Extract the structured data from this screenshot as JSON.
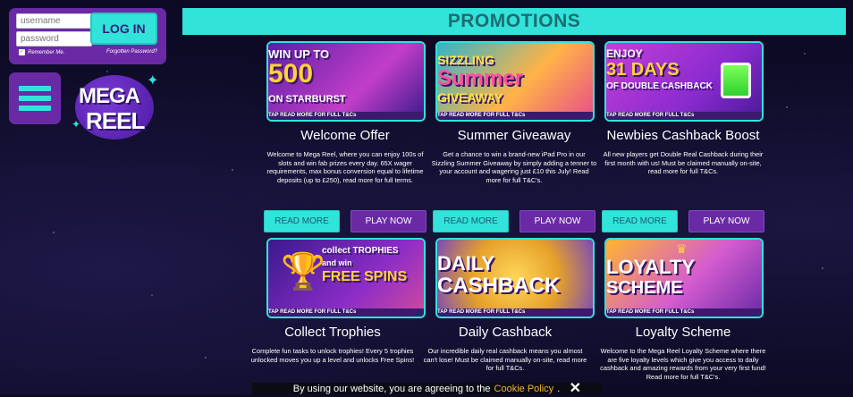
{
  "login": {
    "username_placeholder": "username",
    "password_placeholder": "password",
    "login_label": "LOG IN",
    "remember_label": "Remember Me.",
    "forgot_label": "Forgotten Password?"
  },
  "logo": {
    "line1": "MEGA",
    "line2": "REEL"
  },
  "header": {
    "title": "PROMOTIONS"
  },
  "buttons": {
    "read_more": "READ MORE",
    "play_now": "PLAY NOW"
  },
  "promos": [
    {
      "banner_text": "WIN UP TO 500 FREE SPINS ON STARBURST",
      "banner_line1": "WIN UP TO",
      "banner_line2": "500",
      "banner_line3": "ON STARBURST",
      "tap": "TAP READ MORE FOR FULL T&Cs",
      "title": "Welcome Offer",
      "desc": "Welcome to Mega Reel, where you can enjoy 100s of slots and win fab prizes every day. 65X wager requirements, max bonus conversion equal to lifetime deposits (up to £250), read more for full terms."
    },
    {
      "banner_line1": "SIZZLING",
      "banner_line2": "Summer",
      "banner_line3": "GIVEAWAY",
      "tap": "TAP READ MORE FOR FULL T&Cs",
      "title": "Summer Giveaway",
      "desc": "Get a chance to win a brand-new iPad Pro in our Sizzling Summer Giveaway by simply adding a tenner to your account and wagering just £10 this July! Read more for full T&C's."
    },
    {
      "banner_line1": "ENJOY",
      "banner_line2": "31 DAYS",
      "banner_line3": "OF DOUBLE CASHBACK",
      "tap": "TAP READ MORE FOR FULL T&Cs",
      "title": "Newbies Cashback Boost",
      "desc": "All new players get Double Real Cashback during their first month with us! Must be claimed manually on-site, read more for full T&Cs."
    },
    {
      "banner_line1": "collect TROPHIES",
      "banner_line2": "and win",
      "banner_line3": "FREE SPINS",
      "tap": "TAP READ MORE FOR FULL T&Cs",
      "title": "Collect Trophies",
      "desc": "Complete fun tasks to unlock trophies! Every 5 trophies unlocked moves you up a level and unlocks Free Spins!"
    },
    {
      "banner_line1": "DAILY",
      "banner_line2": "CASHBACK",
      "banner_line3": "",
      "tap": "TAP READ MORE FOR FULL T&Cs",
      "title": "Daily Cashback",
      "desc": "Our incredible daily real cashback means you almost can't lose! Must be claimed manually on-site, read more for full T&Cs."
    },
    {
      "banner_line1": "LOYALTY",
      "banner_line2": "SCHEME",
      "banner_line3": "",
      "tap": "TAP READ MORE FOR FULL T&Cs",
      "title": "Loyalty Scheme",
      "desc": "Welcome to the Mega Reel Loyalty Scheme where there are five loyalty levels which give you access to daily cashback and amazing rewards from your very first fund! Read more for full T&C's."
    }
  ],
  "cookie": {
    "text": "By using our website, you are agreeing to the",
    "link": "Cookie Policy",
    "close": "✕"
  },
  "colors": {
    "teal": "#31e3d9",
    "purple": "#6a2aa6",
    "bg": "#0c0a24"
  }
}
